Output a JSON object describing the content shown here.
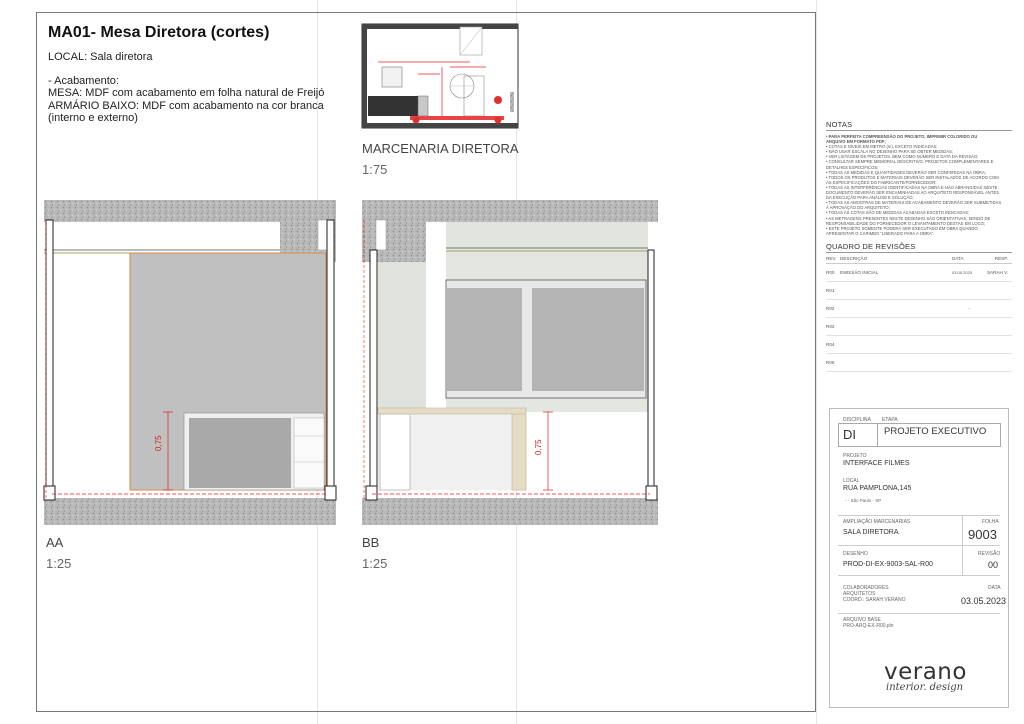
{
  "sheet": {
    "title": "MA01- Mesa Diretora (cortes)",
    "local_line": "LOCAL: Sala diretora",
    "finish_lines": [
      "- Acabamento:",
      "MESA: MDF com acabamento em folha natural de Freijó",
      "ARMÁRIO BAIXO: MDF com acabamento na cor branca",
      "(interno e externo)"
    ]
  },
  "views": {
    "plan": {
      "label": "MARCENARIA DIRETORA",
      "scale": "1:75"
    },
    "aa": {
      "label": "AA",
      "scale": "1:25",
      "dim": "0,75"
    },
    "bb": {
      "label": "BB",
      "scale": "1:25",
      "dim": "0,75"
    }
  },
  "notes": {
    "title": "NOTAS",
    "lines": [
      "• PARA PERFEITA COMPREENSÃO DO PROJETO, IMPRIMIR COLORIDO OU",
      "   ARQUIVO EM FORMATO PDF;",
      "• COTAS E NÍVEIS EM METRO (m), EXCETO INDICADAS;",
      "• NÃO USAR ESCALA NO DESENHO PARA SE OBTER MEDIDAS;",
      "• VER LISTAGEM DE PROJETOS, BEM COMO NÚMERO E DATA DA REVISÃO;",
      "• CONSULTAR SEMPRE MEMORIAL DESCRITIVO, PROJETOS COMPLEMENTARES E",
      "   DETALHES ESPECÍFICOS;",
      "• TODAS AS MEDIDAS E QUANTIDADES DEVERÃO SER CONFERIDAS NA OBRA;",
      "• TODOS OS PRODUTOS E MATERIAIS DEVERÃO SER INSTALADOS DE ACORDO COM",
      "   AS ESPECIFICAÇÕES DO FABRICANTE/FORNECEDOR;",
      "• TODAS AS INTERFERÊNCIAS IDENTIFICADAS NA OBRA E NÃO ABRANGIDAS NESTE",
      "   DOCUMENTO DEVERÃO SER ENCAMINHADAS AO ARQUITETO RESPONSÁVEL ANTES",
      "   DA EXECUÇÃO PARA ANÁLISE E SOLUÇÃO;",
      "• TODAS AS AMOSTRAS DE MATERIAIS DE ACABAMENTO DEVERÃO SER SUBMETIDAS",
      "   À APROVAÇÃO DO ARQUITETO;",
      "• TODAS AS COTAS SÃO DE MEDIDAS ACABADAS EXCETO INDICADAS;",
      "• AS METRAGENS PRESENTES NESTE DESENHO SÃO ORIENTATIVAS, SENDO DE",
      "   RESPONSABILIDADE DO FORNECEDOR O LEVANTAMENTO DESTAS EM LOCO;",
      "• ESTE PROJETO SOMENTE PODERÁ SER EXECUTADO EM OBRA QUANDO",
      "   APRESENTAR O CARIMBO \"LIBERADO PARA A OBRA\"."
    ]
  },
  "revisions": {
    "title": "QUADRO DE REVISÕES",
    "headers": {
      "rev": "REV.",
      "desc": "DESCRIÇÃO",
      "date": "DATA",
      "resp": "RESP."
    },
    "rows": [
      {
        "rev": "R00",
        "desc": "EMISSÃO INICIAL",
        "date": "03.05.2023",
        "resp": "SARAH V."
      },
      {
        "rev": "R01",
        "desc": "",
        "date": "",
        "resp": ""
      },
      {
        "rev": "R02",
        "desc": "",
        "date": "-",
        "resp": ""
      },
      {
        "rev": "R03",
        "desc": "",
        "date": "",
        "resp": ""
      },
      {
        "rev": "R04",
        "desc": "",
        "date": "",
        "resp": ""
      },
      {
        "rev": "R05",
        "desc": "",
        "date": "",
        "resp": ""
      }
    ]
  },
  "title_block": {
    "disciplina_label": "DISCIPLINA",
    "disciplina": "DI",
    "etapa_label": "ETAPA",
    "etapa": "PROJETO EXECUTIVO",
    "projeto_label": "PROJETO",
    "projeto": "INTERFACE FILMES",
    "local_label": "LOCAL",
    "local": "RUA PAMPLONA,145",
    "local_city": "- - São Paulo - SP",
    "ampliacao_label": "AMPLIAÇÃO MARCENARIAS",
    "ampliacao": "SALA DIRETORA",
    "folha_label": "FOLHA",
    "folha": "9003",
    "desenho_label": "DESENHO",
    "desenho": "PROD-DI-EX-9003-SAL-R00",
    "revisao_label": "REVISÃO",
    "revisao": "00",
    "colab_label": "COLABORADORES",
    "arquitetos_label": "ARQUITETOS",
    "coord": "COORD.: SARAH VERANO",
    "data_label": "DATA",
    "data": "03.05.2023",
    "arquivo_label": "ARQUIVO BASE",
    "arquivo": "PRO-ARQ-EX-R00.pln",
    "logo_main": "verano",
    "logo_sub": "interior. design"
  }
}
